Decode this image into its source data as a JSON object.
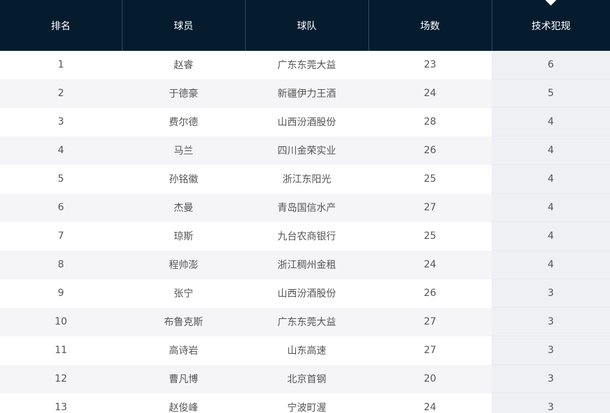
{
  "table": {
    "headers": [
      "排名",
      "球员",
      "球队",
      "场数",
      "技术犯规"
    ],
    "sorted_column": 4,
    "rows": [
      [
        "1",
        "赵睿",
        "广东东莞大益",
        "23",
        "6"
      ],
      [
        "2",
        "于德豪",
        "新疆伊力王酒",
        "24",
        "5"
      ],
      [
        "3",
        "费尔德",
        "山西汾酒股份",
        "28",
        "4"
      ],
      [
        "4",
        "马兰",
        "四川金荣实业",
        "26",
        "4"
      ],
      [
        "5",
        "孙铭徽",
        "浙江东阳光",
        "25",
        "4"
      ],
      [
        "6",
        "杰曼",
        "青岛国信水产",
        "27",
        "4"
      ],
      [
        "7",
        "琼斯",
        "九台农商银行",
        "25",
        "4"
      ],
      [
        "8",
        "程帅澎",
        "浙江稠州金租",
        "24",
        "4"
      ],
      [
        "9",
        "张宁",
        "山西汾酒股份",
        "26",
        "3"
      ],
      [
        "10",
        "布鲁克斯",
        "广东东莞大益",
        "27",
        "3"
      ],
      [
        "11",
        "高诗岩",
        "山东高速",
        "27",
        "3"
      ],
      [
        "12",
        "曹凡博",
        "北京首钢",
        "20",
        "3"
      ],
      [
        "13",
        "赵俊峰",
        "宁波町渥",
        "24",
        "3"
      ]
    ]
  },
  "colors": {
    "header_bg": "#051c2e",
    "header_text": "#ffffff",
    "row_alt_bg": "#f5f5f7",
    "sorted_col_bg": "#eef0f4",
    "cell_text": "#555555"
  },
  "icons": {
    "sort_indicator": "caret-down-icon"
  }
}
